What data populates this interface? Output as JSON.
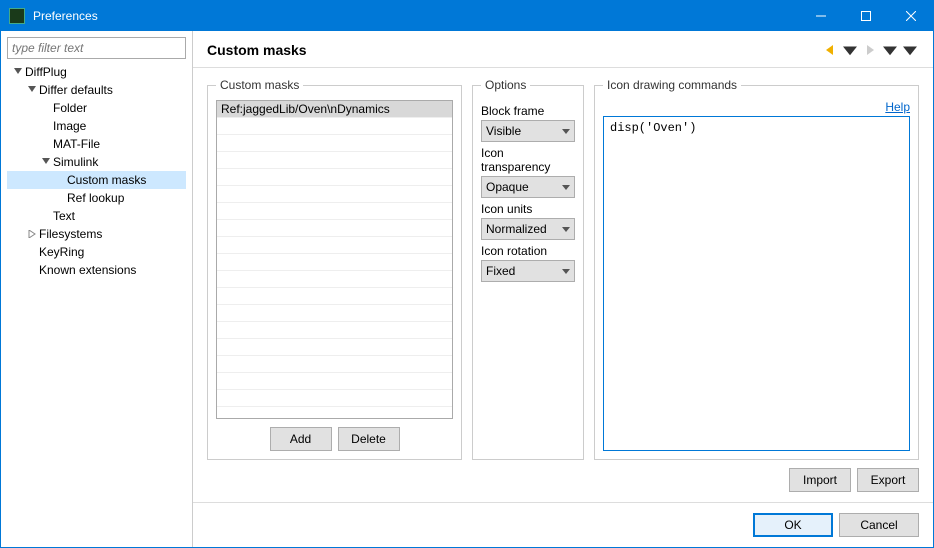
{
  "window": {
    "title": "Preferences"
  },
  "sidebar": {
    "filter_placeholder": "type filter text",
    "tree": {
      "diffplug": "DiffPlug",
      "differ_defaults": "Differ defaults",
      "folder": "Folder",
      "image": "Image",
      "matfile": "MAT-File",
      "simulink": "Simulink",
      "custom_masks": "Custom masks",
      "ref_lookup": "Ref lookup",
      "text": "Text",
      "filesystems": "Filesystems",
      "keyring": "KeyRing",
      "known_ext": "Known extensions"
    }
  },
  "page": {
    "title": "Custom masks",
    "masks_group": "Custom masks",
    "options_group": "Options",
    "cmds_group": "Icon drawing commands",
    "help": "Help",
    "mask_list": [
      "Ref:jaggedLib/Oven\\nDynamics"
    ],
    "options": {
      "block_frame_label": "Block frame",
      "block_frame_value": "Visible",
      "transparency_label": "Icon transparency",
      "transparency_value": "Opaque",
      "units_label": "Icon units",
      "units_value": "Normalized",
      "rotation_label": "Icon rotation",
      "rotation_value": "Fixed"
    },
    "editor_value": "disp('Oven')",
    "buttons": {
      "add": "Add",
      "delete": "Delete",
      "import": "Import",
      "export": "Export"
    }
  },
  "footer": {
    "ok": "OK",
    "cancel": "Cancel"
  }
}
